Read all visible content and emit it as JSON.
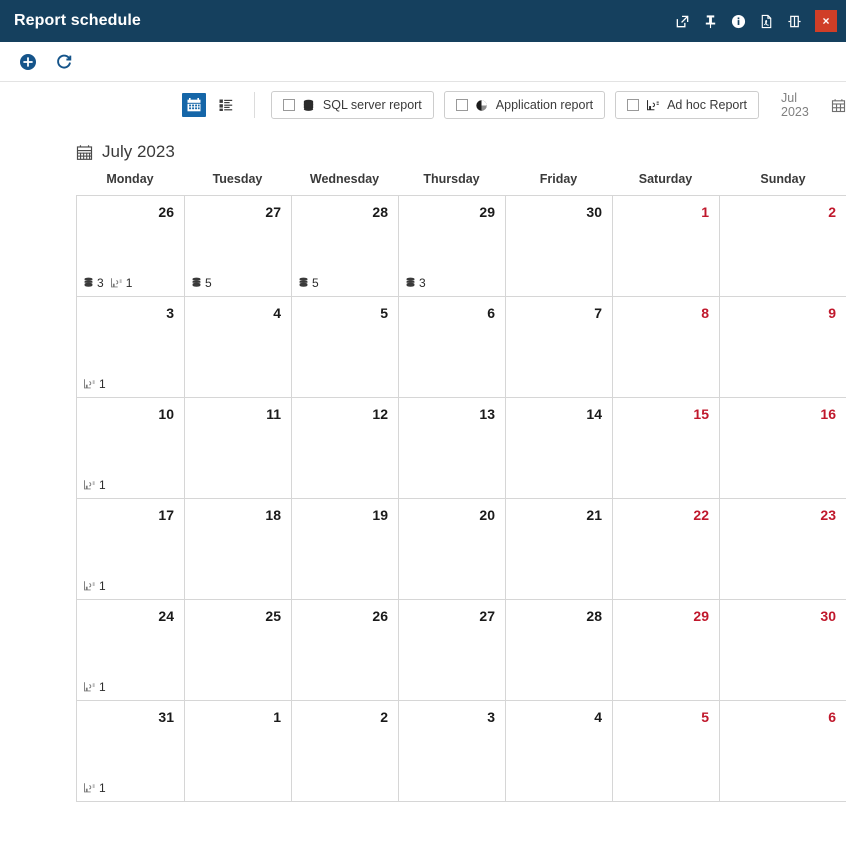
{
  "window": {
    "title": "Report schedule",
    "actions": [
      {
        "name": "popout-icon",
        "label": "Open in new window"
      },
      {
        "name": "pin-icon",
        "label": "Pin"
      },
      {
        "name": "info-icon",
        "label": "Info"
      },
      {
        "name": "pdf-icon",
        "label": "Export PDF"
      },
      {
        "name": "collapse-icon",
        "label": "Collapse panel"
      }
    ],
    "close_label": "×"
  },
  "toolbar": {
    "add_label": "Add",
    "refresh_label": "Refresh"
  },
  "viewbar": {
    "calendar_view_label": "Calendar view",
    "list_view_label": "List view",
    "filters": [
      {
        "id": "sql-server-report",
        "label": "SQL server report",
        "icon": "database-icon",
        "checked": false
      },
      {
        "id": "application-report",
        "label": "Application report",
        "icon": "pie-chart-icon",
        "checked": false
      },
      {
        "id": "ad-hoc-report",
        "label": "Ad hoc Report",
        "icon": "adhoc-report-icon",
        "checked": false
      }
    ],
    "month_picker_value": "Jul 2023"
  },
  "calendar": {
    "heading": "July 2023",
    "daynames": [
      "Monday",
      "Tuesday",
      "Wednesday",
      "Thursday",
      "Friday",
      "Saturday",
      "Sunday"
    ],
    "weeks": [
      [
        {
          "day": "26",
          "weekend": false,
          "badges": [
            {
              "icon": "database-icon",
              "count": "3"
            },
            {
              "icon": "adhoc-report-icon",
              "count": "1"
            }
          ]
        },
        {
          "day": "27",
          "weekend": false,
          "badges": [
            {
              "icon": "database-icon",
              "count": "5"
            }
          ]
        },
        {
          "day": "28",
          "weekend": false,
          "badges": [
            {
              "icon": "database-icon",
              "count": "5"
            }
          ]
        },
        {
          "day": "29",
          "weekend": false,
          "badges": [
            {
              "icon": "database-icon",
              "count": "3"
            }
          ]
        },
        {
          "day": "30",
          "weekend": false,
          "badges": []
        },
        {
          "day": "1",
          "weekend": true,
          "badges": []
        },
        {
          "day": "2",
          "weekend": true,
          "badges": []
        }
      ],
      [
        {
          "day": "3",
          "weekend": false,
          "badges": [
            {
              "icon": "adhoc-report-icon",
              "count": "1"
            }
          ]
        },
        {
          "day": "4",
          "weekend": false,
          "badges": []
        },
        {
          "day": "5",
          "weekend": false,
          "badges": []
        },
        {
          "day": "6",
          "weekend": false,
          "badges": []
        },
        {
          "day": "7",
          "weekend": false,
          "badges": []
        },
        {
          "day": "8",
          "weekend": true,
          "badges": []
        },
        {
          "day": "9",
          "weekend": true,
          "badges": []
        }
      ],
      [
        {
          "day": "10",
          "weekend": false,
          "badges": [
            {
              "icon": "adhoc-report-icon",
              "count": "1"
            }
          ]
        },
        {
          "day": "11",
          "weekend": false,
          "badges": []
        },
        {
          "day": "12",
          "weekend": false,
          "badges": []
        },
        {
          "day": "13",
          "weekend": false,
          "badges": []
        },
        {
          "day": "14",
          "weekend": false,
          "badges": []
        },
        {
          "day": "15",
          "weekend": true,
          "badges": []
        },
        {
          "day": "16",
          "weekend": true,
          "badges": []
        }
      ],
      [
        {
          "day": "17",
          "weekend": false,
          "badges": [
            {
              "icon": "adhoc-report-icon",
              "count": "1"
            }
          ]
        },
        {
          "day": "18",
          "weekend": false,
          "badges": []
        },
        {
          "day": "19",
          "weekend": false,
          "badges": []
        },
        {
          "day": "20",
          "weekend": false,
          "badges": []
        },
        {
          "day": "21",
          "weekend": false,
          "badges": []
        },
        {
          "day": "22",
          "weekend": true,
          "badges": []
        },
        {
          "day": "23",
          "weekend": true,
          "badges": []
        }
      ],
      [
        {
          "day": "24",
          "weekend": false,
          "badges": [
            {
              "icon": "adhoc-report-icon",
              "count": "1"
            }
          ]
        },
        {
          "day": "25",
          "weekend": false,
          "badges": []
        },
        {
          "day": "26",
          "weekend": false,
          "badges": []
        },
        {
          "day": "27",
          "weekend": false,
          "badges": []
        },
        {
          "day": "28",
          "weekend": false,
          "badges": []
        },
        {
          "day": "29",
          "weekend": true,
          "badges": []
        },
        {
          "day": "30",
          "weekend": true,
          "badges": []
        }
      ],
      [
        {
          "day": "31",
          "weekend": false,
          "badges": [
            {
              "icon": "adhoc-report-icon",
              "count": "1"
            }
          ]
        },
        {
          "day": "1",
          "weekend": false,
          "badges": []
        },
        {
          "day": "2",
          "weekend": false,
          "badges": []
        },
        {
          "day": "3",
          "weekend": false,
          "badges": []
        },
        {
          "day": "4",
          "weekend": false,
          "badges": []
        },
        {
          "day": "5",
          "weekend": true,
          "badges": []
        },
        {
          "day": "6",
          "weekend": true,
          "badges": []
        }
      ]
    ]
  },
  "colors": {
    "titlebar": "#15405e",
    "close": "#d03e27",
    "accent": "#1566a8",
    "weekend": "#c0182c",
    "grid_line": "#d6d6d6"
  }
}
